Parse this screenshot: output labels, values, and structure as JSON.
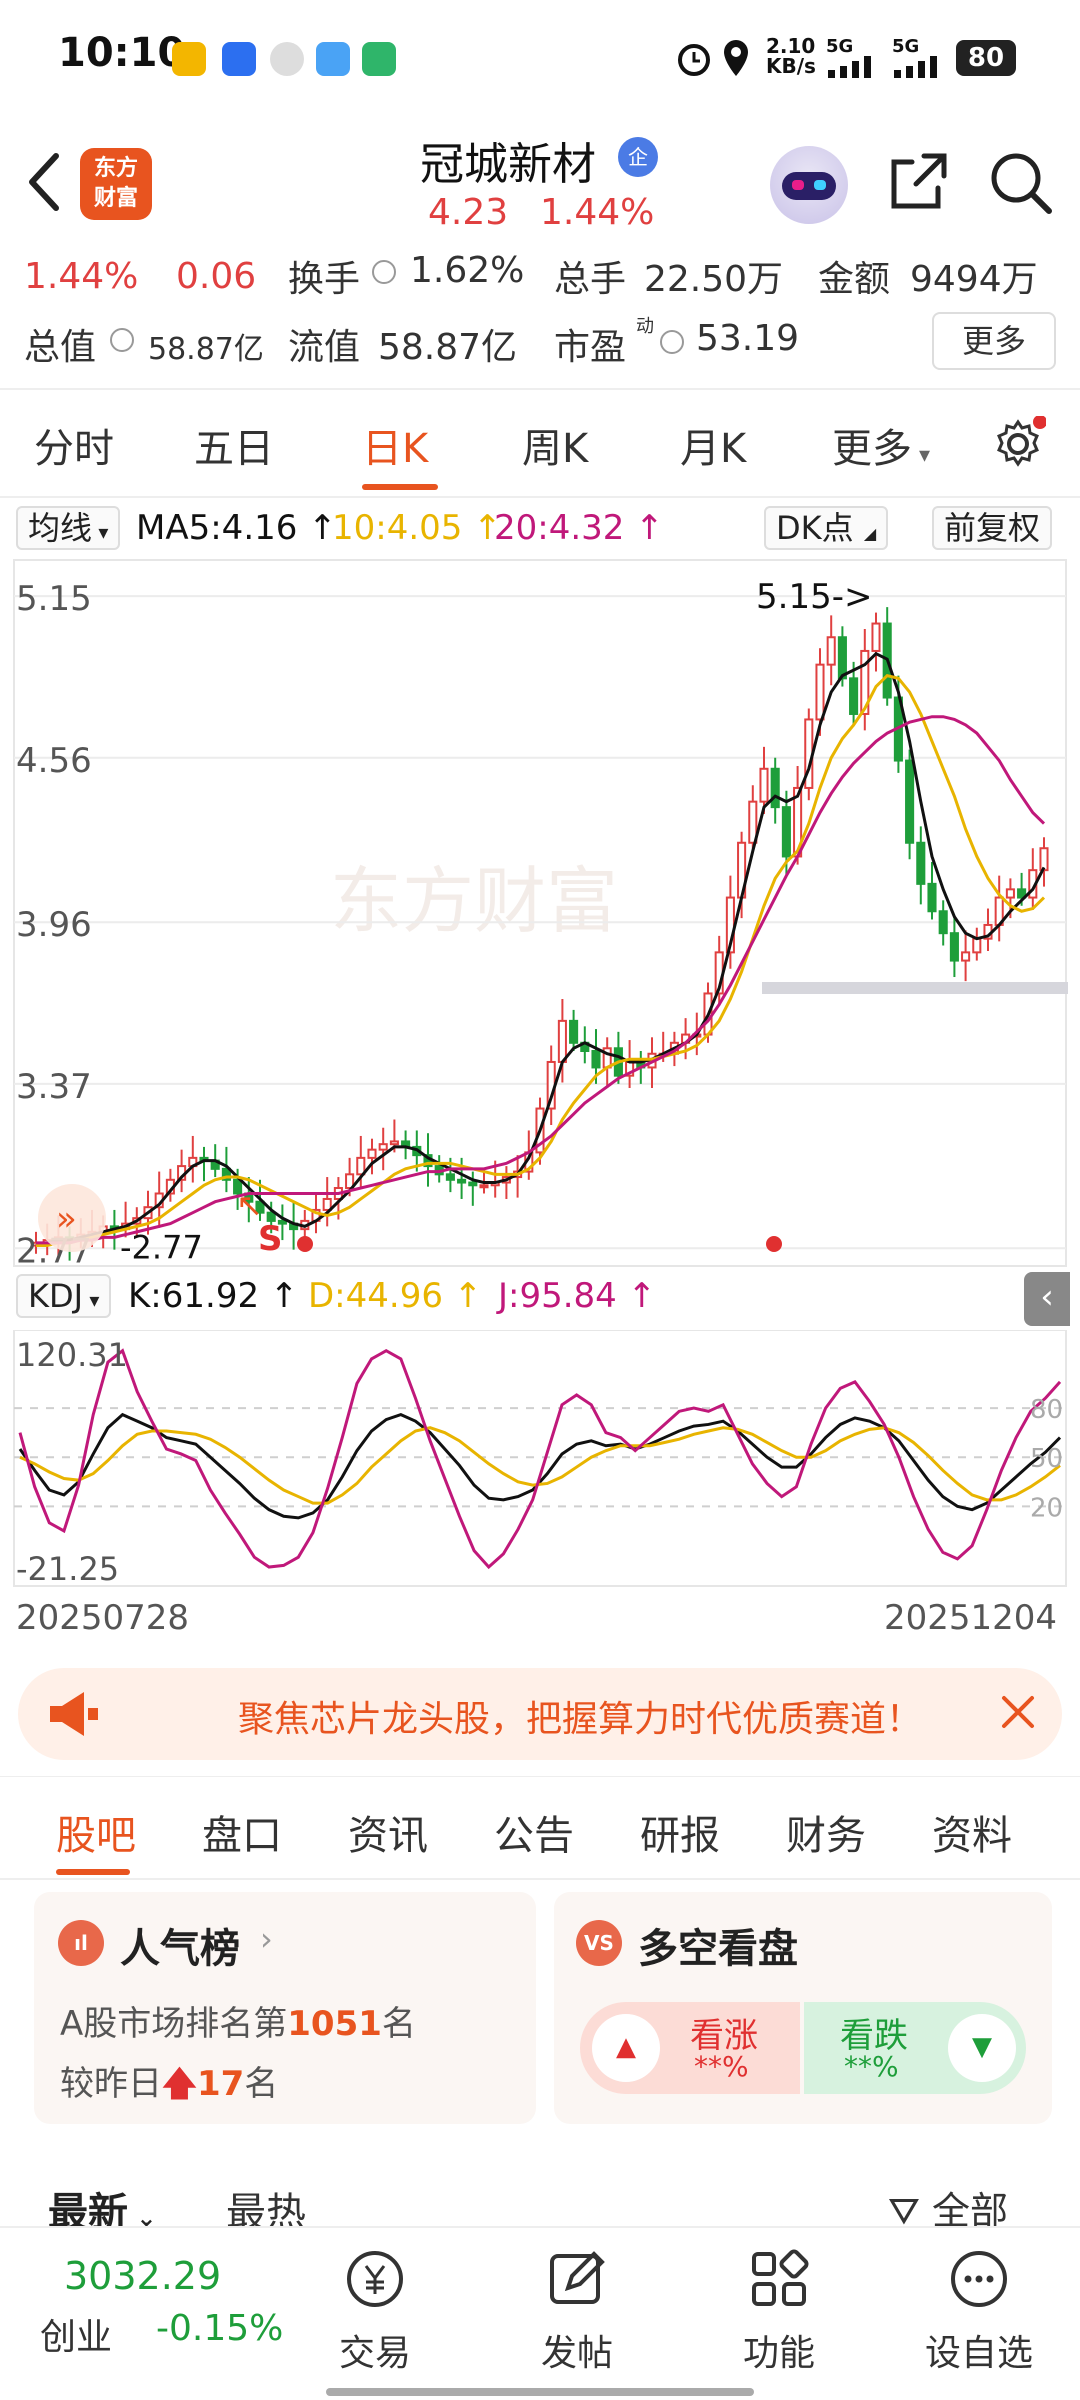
{
  "status_bar": {
    "time": "10:10",
    "net_speed": "2.10",
    "net_unit": "KB/s",
    "sim1": "5G",
    "sim2": "5G",
    "battery": "80"
  },
  "header": {
    "stock_name": "冠城新材",
    "badge": "企",
    "price": "4.23",
    "change_pct": "1.44%",
    "logo_line1": "东方",
    "logo_line2": "财富"
  },
  "quote": {
    "row1": {
      "pct": "1.44%",
      "chg": "0.06",
      "turnover_label": "换手",
      "turnover": "1.62%",
      "volume_label": "总手",
      "volume": "22.50万",
      "amount_label": "金额",
      "amount": "9494万"
    },
    "row2": {
      "mcap_label": "总值",
      "mcap": "58.87亿",
      "float_label": "流值",
      "float": "58.87亿",
      "pe_label": "市盈",
      "pe_sup": "动",
      "pe": "53.19"
    },
    "more": "更多"
  },
  "period_tabs": [
    "分时",
    "五日",
    "日K",
    "周K",
    "月K",
    "更多"
  ],
  "active_period": "日K",
  "chart_toolbar": {
    "indicator": "均线",
    "ma5": "MA5:4.16",
    "ma10": "10:4.05",
    "ma20": "20:4.32",
    "dk": "DK点",
    "adjust": "前复权"
  },
  "kdj_toolbar": {
    "indicator": "KDJ",
    "k": "K:61.92",
    "d": "D:44.96",
    "j": "J:95.84"
  },
  "colors": {
    "accent": "#e8541f",
    "up": "#e04040",
    "down": "#1e9e3a",
    "ma5": "#111111",
    "ma10": "#e8b400",
    "ma20": "#c0187a"
  },
  "chart_data": [
    {
      "type": "candlestick",
      "y_ticks": [
        "5.15",
        "4.56",
        "3.96",
        "3.37",
        "2.77"
      ],
      "ylim": [
        2.72,
        5.26
      ],
      "low_marker": "2.77",
      "high_marker": "5.15->",
      "signal_label": "S",
      "watermark": "东方财富",
      "close": [
        2.79,
        2.8,
        2.81,
        2.8,
        2.82,
        2.83,
        2.85,
        2.84,
        2.86,
        2.88,
        2.92,
        2.97,
        3.02,
        3.07,
        3.1,
        3.09,
        3.06,
        3.02,
        2.97,
        2.94,
        2.9,
        2.87,
        2.86,
        2.84,
        2.87,
        2.91,
        2.95,
        2.99,
        3.04,
        3.1,
        3.13,
        3.15,
        3.16,
        3.14,
        3.11,
        3.07,
        3.04,
        3.02,
        3.01,
        3.0,
        3.0,
        3.01,
        3.03,
        3.05,
        3.12,
        3.28,
        3.45,
        3.6,
        3.52,
        3.49,
        3.43,
        3.5,
        3.4,
        3.45,
        3.43,
        3.48,
        3.48,
        3.52,
        3.55,
        3.55,
        3.7,
        3.85,
        4.05,
        4.25,
        4.4,
        4.52,
        4.38,
        4.2,
        4.45,
        4.7,
        4.9,
        5.0,
        4.85,
        4.72,
        4.95,
        5.05,
        4.78,
        4.55,
        4.25,
        4.1,
        4.0,
        3.92,
        3.82,
        3.85,
        3.9,
        3.95,
        4.05,
        4.08,
        4.05,
        4.15,
        4.23
      ],
      "ma5": [
        2.78,
        2.79,
        2.8,
        2.8,
        2.81,
        2.82,
        2.83,
        2.84,
        2.85,
        2.87,
        2.9,
        2.93,
        2.98,
        3.03,
        3.07,
        3.09,
        3.09,
        3.07,
        3.03,
        2.99,
        2.95,
        2.91,
        2.88,
        2.86,
        2.85,
        2.87,
        2.9,
        2.94,
        2.98,
        3.03,
        3.08,
        3.11,
        3.14,
        3.14,
        3.13,
        3.1,
        3.08,
        3.06,
        3.04,
        3.02,
        3.01,
        3.01,
        3.02,
        3.04,
        3.1,
        3.2,
        3.32,
        3.45,
        3.5,
        3.52,
        3.5,
        3.48,
        3.47,
        3.45,
        3.45,
        3.46,
        3.48,
        3.5,
        3.52,
        3.55,
        3.62,
        3.72,
        3.88,
        4.05,
        4.22,
        4.38,
        4.42,
        4.4,
        4.42,
        4.52,
        4.68,
        4.8,
        4.86,
        4.88,
        4.9,
        4.94,
        4.92,
        4.8,
        4.62,
        4.4,
        4.2,
        4.08,
        3.98,
        3.92,
        3.9,
        3.91,
        3.95,
        4.0,
        4.04,
        4.08,
        4.16
      ],
      "ma10": [
        2.78,
        2.78,
        2.79,
        2.79,
        2.8,
        2.81,
        2.82,
        2.83,
        2.84,
        2.85,
        2.86,
        2.88,
        2.91,
        2.94,
        2.97,
        3.0,
        3.02,
        3.03,
        3.03,
        3.02,
        3.0,
        2.98,
        2.96,
        2.94,
        2.92,
        2.9,
        2.89,
        2.9,
        2.92,
        2.95,
        2.98,
        3.01,
        3.04,
        3.06,
        3.07,
        3.08,
        3.08,
        3.08,
        3.07,
        3.06,
        3.05,
        3.04,
        3.04,
        3.04,
        3.06,
        3.1,
        3.16,
        3.24,
        3.3,
        3.35,
        3.4,
        3.43,
        3.45,
        3.46,
        3.46,
        3.46,
        3.47,
        3.48,
        3.49,
        3.51,
        3.55,
        3.6,
        3.68,
        3.78,
        3.9,
        4.02,
        4.12,
        4.18,
        4.22,
        4.32,
        4.45,
        4.56,
        4.63,
        4.68,
        4.74,
        4.82,
        4.86,
        4.85,
        4.8,
        4.72,
        4.62,
        4.52,
        4.42,
        4.3,
        4.2,
        4.12,
        4.06,
        4.02,
        4.0,
        4.01,
        4.05
      ],
      "ma20": [
        2.79,
        2.79,
        2.79,
        2.79,
        2.8,
        2.8,
        2.81,
        2.81,
        2.82,
        2.83,
        2.84,
        2.85,
        2.86,
        2.88,
        2.9,
        2.92,
        2.94,
        2.95,
        2.96,
        2.97,
        2.97,
        2.97,
        2.97,
        2.97,
        2.97,
        2.97,
        2.97,
        2.97,
        2.98,
        2.99,
        3.0,
        3.01,
        3.02,
        3.03,
        3.04,
        3.05,
        3.05,
        3.06,
        3.06,
        3.06,
        3.06,
        3.07,
        3.08,
        3.1,
        3.12,
        3.15,
        3.18,
        3.22,
        3.26,
        3.3,
        3.33,
        3.36,
        3.39,
        3.41,
        3.43,
        3.45,
        3.47,
        3.49,
        3.52,
        3.56,
        3.6,
        3.66,
        3.73,
        3.81,
        3.89,
        3.97,
        4.05,
        4.13,
        4.2,
        4.28,
        4.36,
        4.43,
        4.49,
        4.54,
        4.58,
        4.62,
        4.65,
        4.67,
        4.69,
        4.7,
        4.71,
        4.71,
        4.7,
        4.68,
        4.65,
        4.6,
        4.55,
        4.48,
        4.42,
        4.36,
        4.32
      ]
    },
    {
      "type": "line",
      "name": "KDJ",
      "y_ticks": [
        "120.31",
        "-21.25"
      ],
      "guide_levels": [
        80,
        50,
        20
      ],
      "guide_labels": [
        "80",
        "50",
        "20"
      ],
      "ylim": [
        -21.25,
        120.31
      ],
      "x_range": [
        "20250728",
        "20251204"
      ],
      "series": [
        {
          "name": "K",
          "values": [
            55,
            42,
            30,
            27,
            35,
            52,
            68,
            76,
            72,
            68,
            62,
            60,
            58,
            50,
            42,
            34,
            25,
            18,
            14,
            13,
            16,
            24,
            38,
            54,
            66,
            73,
            76,
            72,
            65,
            55,
            45,
            33,
            25,
            24,
            26,
            30,
            40,
            52,
            58,
            60,
            57,
            58,
            55,
            58,
            62,
            66,
            69,
            70,
            72,
            66,
            58,
            50,
            44,
            44,
            52,
            62,
            70,
            74,
            72,
            68,
            60,
            48,
            36,
            26,
            20,
            18,
            22,
            30,
            38,
            46,
            53,
            62
          ]
        },
        {
          "name": "D",
          "values": [
            50,
            46,
            41,
            37,
            36,
            40,
            48,
            57,
            64,
            66,
            66,
            65,
            64,
            61,
            56,
            50,
            43,
            36,
            30,
            26,
            22,
            22,
            27,
            34,
            44,
            52,
            60,
            66,
            68,
            65,
            60,
            53,
            46,
            40,
            35,
            33,
            34,
            38,
            44,
            50,
            54,
            57,
            57,
            57,
            59,
            61,
            64,
            66,
            68,
            67,
            64,
            59,
            54,
            50,
            50,
            54,
            60,
            64,
            67,
            68,
            65,
            59,
            51,
            42,
            34,
            27,
            24,
            24,
            27,
            32,
            38,
            45
          ]
        },
        {
          "name": "J",
          "values": [
            65,
            32,
            10,
            5,
            33,
            76,
            108,
            115,
            90,
            72,
            55,
            52,
            48,
            30,
            16,
            3,
            -11,
            -17,
            -16,
            -11,
            4,
            31,
            62,
            95,
            110,
            115,
            110,
            86,
            60,
            37,
            14,
            -7,
            -17,
            -9,
            6,
            24,
            53,
            82,
            88,
            82,
            65,
            62,
            54,
            62,
            70,
            78,
            80,
            78,
            82,
            64,
            46,
            34,
            26,
            32,
            58,
            80,
            92,
            96,
            84,
            70,
            50,
            26,
            6,
            -8,
            -12,
            -4,
            18,
            42,
            62,
            78,
            86,
            96
          ]
        }
      ]
    }
  ],
  "banner": {
    "text": "聚焦芯片龙头股，把握算力时代优质赛道！"
  },
  "sub_tabs": [
    "股吧",
    "盘口",
    "资讯",
    "公告",
    "研报",
    "财务",
    "资料"
  ],
  "popularity": {
    "title": "人气榜",
    "line1_prefix": "A股市场排名第",
    "rank": "1051",
    "line1_suffix": "名",
    "line2_prefix": "较昨日",
    "delta": "17",
    "line2_suffix": "名"
  },
  "longshort": {
    "title": "多空看盘",
    "up_label": "看涨",
    "up_value": "**%",
    "down_label": "看跌",
    "down_value": "**%"
  },
  "feed_tabs": {
    "latest": "最新",
    "hot": "最热",
    "filter": "全部"
  },
  "bottom_nav": {
    "index_value": "3032.29",
    "index_name": "创业",
    "index_change": "-0.15%",
    "items": [
      "交易",
      "发帖",
      "功能",
      "设自选"
    ]
  }
}
